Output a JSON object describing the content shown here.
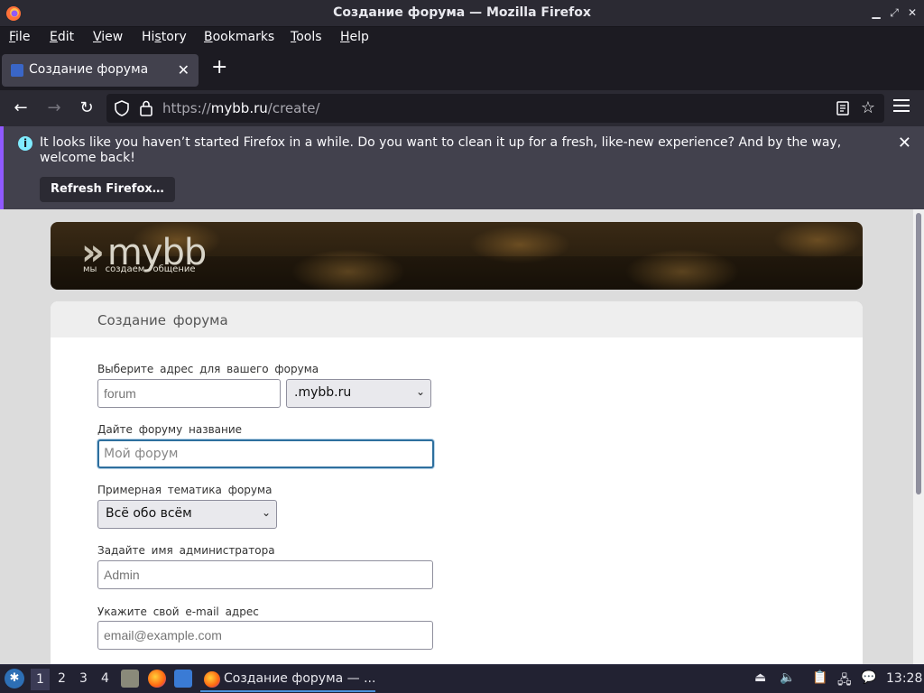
{
  "window": {
    "title": "Создание форума — Mozilla Firefox"
  },
  "menubar": {
    "items": [
      {
        "label": "File",
        "accel": "F",
        "rest": "ile"
      },
      {
        "label": "Edit",
        "accel": "E",
        "rest": "dit"
      },
      {
        "label": "View",
        "accel": "V",
        "rest": "iew"
      },
      {
        "label": "History",
        "accel": "s",
        "pre": "Hi",
        "rest": "tory"
      },
      {
        "label": "Bookmarks",
        "accel": "B",
        "rest": "ookmarks"
      },
      {
        "label": "Tools",
        "accel": "T",
        "rest": "ools"
      },
      {
        "label": "Help",
        "accel": "H",
        "rest": "elp"
      }
    ]
  },
  "tabs": [
    {
      "label": "Создание форума",
      "active": true
    }
  ],
  "navbar": {
    "url_prefix": "https://",
    "url_host": "mybb.ru",
    "url_path": "/create/"
  },
  "notification": {
    "message": "It looks like you haven’t started Firefox in a while. Do you want to clean it up for a fresh, like-new experience? And by the way, welcome back!",
    "button_label": "Refresh Firefox…"
  },
  "banner": {
    "logo_text": "mybb",
    "tagline": "мы создаем общение"
  },
  "form": {
    "heading": "Создание форума",
    "address_label": "Выберите адрес для вашего форума",
    "address_placeholder": "forum",
    "domain_selected": ".mybb.ru",
    "name_label": "Дайте форуму название",
    "name_placeholder": "Мой форум",
    "topic_label": "Примерная тематика форума",
    "topic_selected": "Всё обо всём",
    "admin_label": "Задайте имя администратора",
    "admin_placeholder": "Admin",
    "email_label": "Укажите свой e-mail адрес",
    "email_placeholder": "email@example.com"
  },
  "taskbar": {
    "workspaces": [
      "1",
      "2",
      "3",
      "4"
    ],
    "active_workspace": "1",
    "task_label": "Создание форума — ...",
    "clock": "13:28"
  },
  "colors": {
    "accent": "#9059ff",
    "focus_border": "#2e6f9e"
  }
}
